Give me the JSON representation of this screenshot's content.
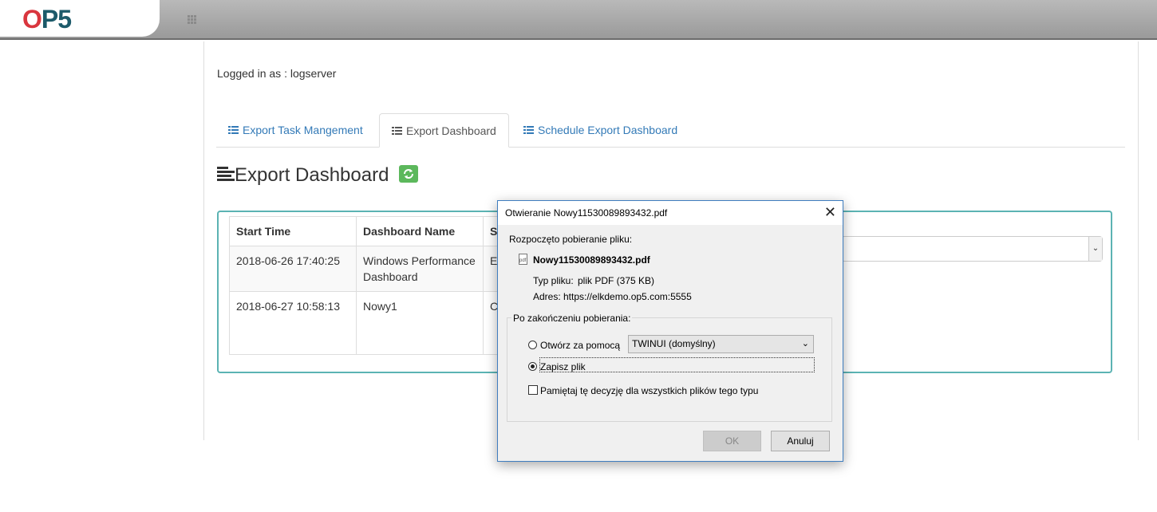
{
  "header": {
    "logo_text_o": "O",
    "logo_text_rest": "P5"
  },
  "user": {
    "logged_in_text": "Logged in as : logserver"
  },
  "tabs": [
    {
      "label": "Export Task Mangement",
      "icon": "list-icon"
    },
    {
      "label": "Export Dashboard",
      "icon": "list-icon"
    },
    {
      "label": "Schedule Export Dashboard",
      "icon": "list-icon"
    }
  ],
  "page": {
    "title": "Export Dashboard",
    "refresh_icon": "refresh-icon",
    "accent": "#5cb85c"
  },
  "table": {
    "headers": [
      "Start Time",
      "Dashboard Name",
      "St"
    ],
    "rows": [
      {
        "start_time": "2018-06-26 17:40:25",
        "dashboard_name_line1": "Windows Performance",
        "dashboard_name_line2": "Dashboard",
        "status": "Er"
      },
      {
        "start_time": "2018-06-27 10:58:13",
        "dashboard_name_line1": "Nowy1",
        "dashboard_name_line2": "",
        "status": "Co"
      }
    ]
  },
  "dialog": {
    "title": "Otwieranie Nowy11530089893432.pdf",
    "close_icon": "close-icon",
    "started_text": "Rozpoczęto pobieranie pliku:",
    "file_name": "Nowy11530089893432.pdf",
    "file_type_label": "Typ pliku:",
    "file_type_value": "plik PDF (375 KB)",
    "address_label": "Adres:",
    "address_value": "https://elkdemo.op5.com:5555",
    "after_download_label": "Po zakończeniu pobierania:",
    "open_with_label": "Otwórz za pomocą",
    "open_with_app": "TWINUI (domyślny)",
    "save_file_label": "Zapisz plik",
    "remember_label": "Pamiętaj tę decyzję dla wszystkich plików tego typu",
    "ok_label": "OK",
    "cancel_label": "Anuluj",
    "selected_option": "save_file",
    "remember_checked": false,
    "border_color": "#3f7dbf"
  }
}
